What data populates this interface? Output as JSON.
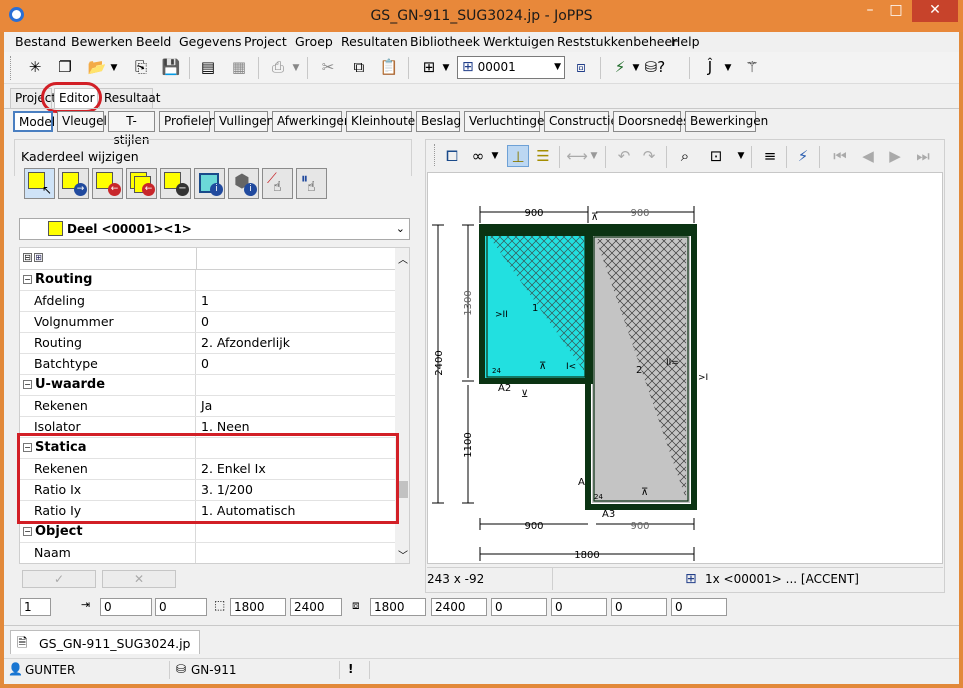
{
  "window": {
    "title": "GS_GN-911_SUG3024.jp - JoPPS",
    "minimize": "–",
    "maximize": "□",
    "close": "✕"
  },
  "menu": [
    "Bestand",
    "Bewerken",
    "Beeld",
    "Gegevens",
    "Project",
    "Groep",
    "Resultaten",
    "Bibliotheek",
    "Werktuigen",
    "Reststukkenbeheer",
    "Help"
  ],
  "toolbar": {
    "combo_value": "00001",
    "combo_icon": "grid-icon"
  },
  "main_tabs": [
    "Project",
    "Editor",
    "Resultaat"
  ],
  "active_main_tab": "Editor",
  "module_tabs": [
    "Model",
    "Vleugel",
    "T-stijlen",
    "Profielen",
    "Vullingen",
    "Afwerkingen",
    "Kleinhouten",
    "Beslag",
    "Verluchtingen",
    "Constructie",
    "Doorsnedes",
    "Bewerkingen"
  ],
  "left": {
    "title": "Kaderdeel wijzigen",
    "part_select": "Deel <00001><1>",
    "expand_all": "⊟",
    "collapse_all": "⊞",
    "properties": [
      {
        "type": "section",
        "label": "Routing"
      },
      {
        "type": "prop",
        "label": "Afdeling",
        "value": "1"
      },
      {
        "type": "prop",
        "label": "Volgnummer",
        "value": "0"
      },
      {
        "type": "prop",
        "label": "Routing",
        "value": "2. Afzonderlijk"
      },
      {
        "type": "prop",
        "label": "Batchtype",
        "value": "0"
      },
      {
        "type": "section",
        "label": "U-waarde"
      },
      {
        "type": "prop",
        "label": "Rekenen",
        "value": "Ja"
      },
      {
        "type": "prop",
        "label": "Isolator",
        "value": "1. Neen"
      },
      {
        "type": "section",
        "label": "Statica"
      },
      {
        "type": "prop",
        "label": "Rekenen",
        "value": "2. Enkel Ix"
      },
      {
        "type": "prop",
        "label": "Ratio Ix",
        "value": "3. 1/200"
      },
      {
        "type": "prop",
        "label": "Ratio Iy",
        "value": "1. Automatisch"
      },
      {
        "type": "section",
        "label": "Object"
      },
      {
        "type": "prop",
        "label": "Naam",
        "value": ""
      }
    ],
    "ok_button": "✓",
    "cancel_button": "✕"
  },
  "drawing": {
    "dims_top": [
      "900",
      "900"
    ],
    "dims_bottom": [
      "900",
      "900"
    ],
    "dim_total_width": "1800",
    "dim_height_total": "2400",
    "dim_height_upper": "1300",
    "dim_height_lower": "1100",
    "labels": {
      "hinge_left": ">II",
      "hinge_right": ">I",
      "mid": "II=",
      "a2": "A2",
      "a3": "A3",
      "a": "A",
      "k": "I<",
      "n1": "24",
      "n2": "24",
      "one": "1",
      "two": "2"
    },
    "colors": {
      "glass": "#22e0e0",
      "panel": "#c4c4c4",
      "frame": "#0b3313"
    }
  },
  "view_status": {
    "coords": "243 x -92",
    "selection": "1x <00001> ... [ACCENT]"
  },
  "bottom_fields": {
    "count": "1",
    "pos_x": "0",
    "pos_y": "0",
    "size_w": "1800",
    "size_h": "2400",
    "outer_w": "1800",
    "outer_h": "2400",
    "v1": "0",
    "v2": "0",
    "v3": "0",
    "v4": "0"
  },
  "doc_tab": "GS_GN-911_SUG3024.jp",
  "status": {
    "user": "GUNTER",
    "db": "GN-911",
    "alert": "!"
  }
}
